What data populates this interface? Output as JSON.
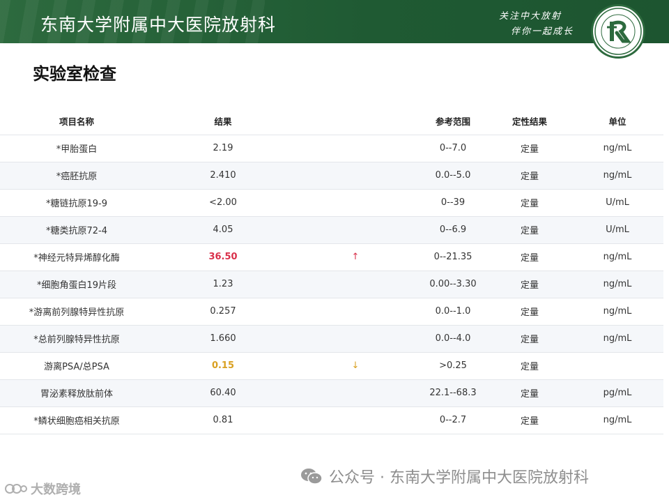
{
  "header": {
    "title": "东南大学附属中大医院放射科",
    "slogan_line1": "关注中大放射",
    "slogan_line2": "伴你一起成长"
  },
  "page_title": "实验室检查",
  "table": {
    "headers": {
      "name": "项目名称",
      "result": "结果",
      "reference": "参考范围",
      "qualitative": "定性结果",
      "unit": "单位"
    },
    "rows": [
      {
        "name": "*甲胎蛋白",
        "result": "2.19",
        "flag": "",
        "reference": "0--7.0",
        "qualitative": "定量",
        "unit": "ng/mL"
      },
      {
        "name": "*癌胚抗原",
        "result": "2.410",
        "flag": "",
        "reference": "0.0--5.0",
        "qualitative": "定量",
        "unit": "ng/mL"
      },
      {
        "name": "*糖链抗原19-9",
        "result": "<2.00",
        "flag": "",
        "reference": "0--39",
        "qualitative": "定量",
        "unit": "U/mL"
      },
      {
        "name": "*糖类抗原72-4",
        "result": "4.05",
        "flag": "",
        "reference": "0--6.9",
        "qualitative": "定量",
        "unit": "U/mL"
      },
      {
        "name": "*神经元特异烯醇化酶",
        "result": "36.50",
        "flag": "↑",
        "status": "high",
        "reference": "0--21.35",
        "qualitative": "定量",
        "unit": "ng/mL"
      },
      {
        "name": "*细胞角蛋白19片段",
        "result": "1.23",
        "flag": "",
        "reference": "0.00--3.30",
        "qualitative": "定量",
        "unit": "ng/mL"
      },
      {
        "name": "*游离前列腺特异性抗原",
        "result": "0.257",
        "flag": "",
        "reference": "0.0--1.0",
        "qualitative": "定量",
        "unit": "ng/mL"
      },
      {
        "name": "*总前列腺特异性抗原",
        "result": "1.660",
        "flag": "",
        "reference": "0.0--4.0",
        "qualitative": "定量",
        "unit": "ng/mL"
      },
      {
        "name": "游离PSA/总PSA",
        "result": "0.15",
        "flag": "↓",
        "status": "low",
        "reference": ">0.25",
        "qualitative": "定量",
        "unit": ""
      },
      {
        "name": "胃泌素释放肽前体",
        "result": "60.40",
        "flag": "",
        "reference": "22.1--68.3",
        "qualitative": "定量",
        "unit": "pg/mL"
      },
      {
        "name": "*鳞状细胞癌相关抗原",
        "result": "0.81",
        "flag": "",
        "reference": "0--2.7",
        "qualitative": "定量",
        "unit": "ng/mL"
      }
    ]
  },
  "footer": {
    "wechat_text": "公众号 · 东南大学附属中大医院放射科",
    "corner_text": "大数跨境"
  },
  "colors": {
    "header_green": "#1f5a33",
    "high": "#d9304a",
    "low": "#d9a021"
  },
  "icons": {
    "logo": "hospital-logo-icon",
    "wechat": "wechat-icon",
    "corner": "watermark-icon"
  }
}
